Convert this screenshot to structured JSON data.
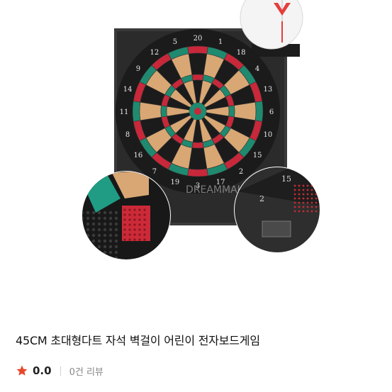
{
  "product": {
    "title": "45CM 초대형다트 자석 벽걸이 어린이 전자보드게임",
    "rating": "0.0",
    "reviews": "0건 리뷰",
    "image": {
      "board_numbers": [
        "20",
        "1",
        "18",
        "4",
        "13",
        "6",
        "10",
        "15",
        "2",
        "17",
        "3",
        "19",
        "7",
        "16",
        "8",
        "11",
        "14",
        "9",
        "12",
        "5"
      ],
      "side_digits": [
        "15",
        "2"
      ],
      "brand_watermark": "DREAMMALL",
      "icons": [
        "star-icon",
        "dart-icon"
      ]
    }
  },
  "colors": {
    "star": "#e5482b",
    "board_red": "#c8283a",
    "board_green": "#1f8a6f",
    "board_beige": "#d9a774",
    "board_black": "#1b1b1b",
    "panel": "#3a3a3a"
  }
}
